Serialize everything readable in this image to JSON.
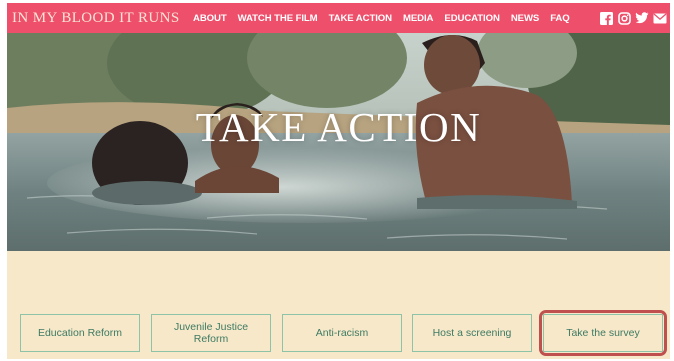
{
  "site": {
    "logo": "IN MY BLOOD IT RUNS"
  },
  "nav": {
    "items": [
      "ABOUT",
      "WATCH THE FILM",
      "TAKE ACTION",
      "MEDIA",
      "EDUCATION",
      "NEWS",
      "FAQ"
    ],
    "social_icons": [
      "facebook-icon",
      "instagram-icon",
      "twitter-icon",
      "email-icon"
    ]
  },
  "hero": {
    "title": "TAKE ACTION"
  },
  "actions": {
    "buttons": [
      "Education Reform",
      "Juvenile Justice Reform",
      "Anti-racism",
      "Host a screening",
      "Take the survey"
    ],
    "highlighted": "Take the survey"
  },
  "colors": {
    "nav_bg": "#ee4f6b",
    "page_bg": "#f7e8c9",
    "button_text": "#3d7a63",
    "button_border": "#8fc3a8",
    "highlight": "#c0504d"
  }
}
